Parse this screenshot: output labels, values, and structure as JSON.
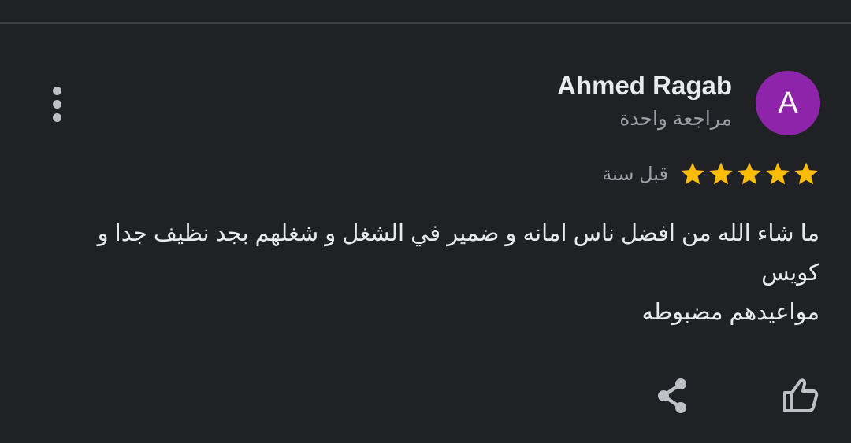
{
  "reviewer": {
    "avatar_letter": "A",
    "avatar_color": "#8e24aa",
    "name": "Ahmed Ragab",
    "review_count_label": "مراجعة واحدة"
  },
  "rating": {
    "stars": 5,
    "max_stars": 5,
    "star_color": "#fbbc04",
    "date_label": "قبل سنة"
  },
  "review": {
    "lines": [
      "ما شاء الله من افضل ناس امانه و ضمير في الشغل و شغلهم بجد نظيف جدا و",
      "كويس",
      "مواعيدهم مضبوطه"
    ]
  },
  "actions": {
    "more_icon": "more-vert-icon",
    "like_icon": "thumb-up-icon",
    "share_icon": "share-icon"
  }
}
